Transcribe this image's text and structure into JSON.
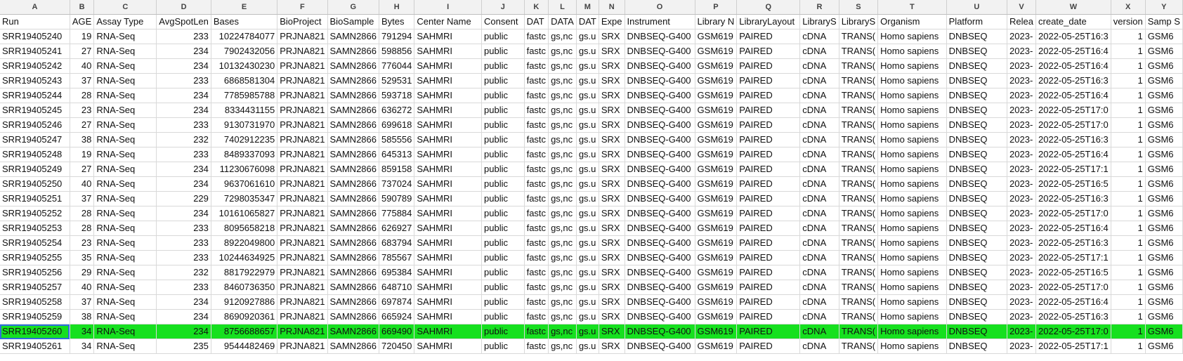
{
  "columns": [
    "A",
    "B",
    "C",
    "D",
    "E",
    "F",
    "G",
    "H",
    "I",
    "J",
    "K",
    "L",
    "M",
    "N",
    "O",
    "P",
    "Q",
    "R",
    "S",
    "T",
    "U",
    "V",
    "W",
    "X",
    "Y"
  ],
  "header_row": [
    "Run",
    "AGE",
    "Assay Type",
    "AvgSpotLen",
    "Bases",
    "BioProject",
    "BioSample",
    "Bytes",
    "Center Name",
    "Consent",
    "DAT",
    "DATA",
    "DAT",
    "Expe",
    "Instrument",
    "Library N",
    "LibraryLayout",
    "LibraryS",
    "LibraryS",
    "Organism",
    "Platform",
    "Relea",
    "create_date",
    "version",
    "Samp S"
  ],
  "rows": [
    [
      "SRR19405240",
      "19",
      "RNA-Seq",
      "233",
      "10224784077",
      "PRJNA821",
      "SAMN2866",
      "791294",
      "SAHMRI",
      "public",
      "fastc",
      "gs,nc",
      "gs.u",
      "SRX",
      "DNBSEQ-G400",
      "GSM619",
      "PAIRED",
      "cDNA",
      "TRANS(",
      "Homo sapiens",
      "DNBSEQ",
      "2023-",
      "2022-05-25T16:3",
      "1",
      "GSM6"
    ],
    [
      "SRR19405241",
      "27",
      "RNA-Seq",
      "234",
      "7902432056",
      "PRJNA821",
      "SAMN2866",
      "598856",
      "SAHMRI",
      "public",
      "fastc",
      "gs,nc",
      "gs.u",
      "SRX",
      "DNBSEQ-G400",
      "GSM619",
      "PAIRED",
      "cDNA",
      "TRANS(",
      "Homo sapiens",
      "DNBSEQ",
      "2023-",
      "2022-05-25T16:4",
      "1",
      "GSM6"
    ],
    [
      "SRR19405242",
      "40",
      "RNA-Seq",
      "234",
      "10132430230",
      "PRJNA821",
      "SAMN2866",
      "776044",
      "SAHMRI",
      "public",
      "fastc",
      "gs,nc",
      "gs.u",
      "SRX",
      "DNBSEQ-G400",
      "GSM619",
      "PAIRED",
      "cDNA",
      "TRANS(",
      "Homo sapiens",
      "DNBSEQ",
      "2023-",
      "2022-05-25T16:4",
      "1",
      "GSM6"
    ],
    [
      "SRR19405243",
      "37",
      "RNA-Seq",
      "233",
      "6868581304",
      "PRJNA821",
      "SAMN2866",
      "529531",
      "SAHMRI",
      "public",
      "fastc",
      "gs,nc",
      "gs.u",
      "SRX",
      "DNBSEQ-G400",
      "GSM619",
      "PAIRED",
      "cDNA",
      "TRANS(",
      "Homo sapiens",
      "DNBSEQ",
      "2023-",
      "2022-05-25T16:3",
      "1",
      "GSM6"
    ],
    [
      "SRR19405244",
      "28",
      "RNA-Seq",
      "234",
      "7785985788",
      "PRJNA821",
      "SAMN2866",
      "593718",
      "SAHMRI",
      "public",
      "fastc",
      "gs,nc",
      "gs.u",
      "SRX",
      "DNBSEQ-G400",
      "GSM619",
      "PAIRED",
      "cDNA",
      "TRANS(",
      "Homo sapiens",
      "DNBSEQ",
      "2023-",
      "2022-05-25T16:4",
      "1",
      "GSM6"
    ],
    [
      "SRR19405245",
      "23",
      "RNA-Seq",
      "234",
      "8334431155",
      "PRJNA821",
      "SAMN2866",
      "636272",
      "SAHMRI",
      "public",
      "fastc",
      "gs,nc",
      "gs.u",
      "SRX",
      "DNBSEQ-G400",
      "GSM619",
      "PAIRED",
      "cDNA",
      "TRANS(",
      "Homo sapiens",
      "DNBSEQ",
      "2023-",
      "2022-05-25T17:0",
      "1",
      "GSM6"
    ],
    [
      "SRR19405246",
      "27",
      "RNA-Seq",
      "233",
      "9130731970",
      "PRJNA821",
      "SAMN2866",
      "699618",
      "SAHMRI",
      "public",
      "fastc",
      "gs,nc",
      "gs.u",
      "SRX",
      "DNBSEQ-G400",
      "GSM619",
      "PAIRED",
      "cDNA",
      "TRANS(",
      "Homo sapiens",
      "DNBSEQ",
      "2023-",
      "2022-05-25T17:0",
      "1",
      "GSM6"
    ],
    [
      "SRR19405247",
      "38",
      "RNA-Seq",
      "232",
      "7402912235",
      "PRJNA821",
      "SAMN2866",
      "585556",
      "SAHMRI",
      "public",
      "fastc",
      "gs,nc",
      "gs.u",
      "SRX",
      "DNBSEQ-G400",
      "GSM619",
      "PAIRED",
      "cDNA",
      "TRANS(",
      "Homo sapiens",
      "DNBSEQ",
      "2023-",
      "2022-05-25T16:3",
      "1",
      "GSM6"
    ],
    [
      "SRR19405248",
      "19",
      "RNA-Seq",
      "233",
      "8489337093",
      "PRJNA821",
      "SAMN2866",
      "645313",
      "SAHMRI",
      "public",
      "fastc",
      "gs,nc",
      "gs.u",
      "SRX",
      "DNBSEQ-G400",
      "GSM619",
      "PAIRED",
      "cDNA",
      "TRANS(",
      "Homo sapiens",
      "DNBSEQ",
      "2023-",
      "2022-05-25T16:4",
      "1",
      "GSM6"
    ],
    [
      "SRR19405249",
      "27",
      "RNA-Seq",
      "234",
      "11230676098",
      "PRJNA821",
      "SAMN2866",
      "859158",
      "SAHMRI",
      "public",
      "fastc",
      "gs,nc",
      "gs.u",
      "SRX",
      "DNBSEQ-G400",
      "GSM619",
      "PAIRED",
      "cDNA",
      "TRANS(",
      "Homo sapiens",
      "DNBSEQ",
      "2023-",
      "2022-05-25T17:1",
      "1",
      "GSM6"
    ],
    [
      "SRR19405250",
      "40",
      "RNA-Seq",
      "234",
      "9637061610",
      "PRJNA821",
      "SAMN2866",
      "737024",
      "SAHMRI",
      "public",
      "fastc",
      "gs,nc",
      "gs.u",
      "SRX",
      "DNBSEQ-G400",
      "GSM619",
      "PAIRED",
      "cDNA",
      "TRANS(",
      "Homo sapiens",
      "DNBSEQ",
      "2023-",
      "2022-05-25T16:5",
      "1",
      "GSM6"
    ],
    [
      "SRR19405251",
      "37",
      "RNA-Seq",
      "229",
      "7298035347",
      "PRJNA821",
      "SAMN2866",
      "590789",
      "SAHMRI",
      "public",
      "fastc",
      "gs,nc",
      "gs.u",
      "SRX",
      "DNBSEQ-G400",
      "GSM619",
      "PAIRED",
      "cDNA",
      "TRANS(",
      "Homo sapiens",
      "DNBSEQ",
      "2023-",
      "2022-05-25T16:3",
      "1",
      "GSM6"
    ],
    [
      "SRR19405252",
      "28",
      "RNA-Seq",
      "234",
      "10161065827",
      "PRJNA821",
      "SAMN2866",
      "775884",
      "SAHMRI",
      "public",
      "fastc",
      "gs,nc",
      "gs.u",
      "SRX",
      "DNBSEQ-G400",
      "GSM619",
      "PAIRED",
      "cDNA",
      "TRANS(",
      "Homo sapiens",
      "DNBSEQ",
      "2023-",
      "2022-05-25T17:0",
      "1",
      "GSM6"
    ],
    [
      "SRR19405253",
      "28",
      "RNA-Seq",
      "233",
      "8095658218",
      "PRJNA821",
      "SAMN2866",
      "626927",
      "SAHMRI",
      "public",
      "fastc",
      "gs,nc",
      "gs.u",
      "SRX",
      "DNBSEQ-G400",
      "GSM619",
      "PAIRED",
      "cDNA",
      "TRANS(",
      "Homo sapiens",
      "DNBSEQ",
      "2023-",
      "2022-05-25T16:4",
      "1",
      "GSM6"
    ],
    [
      "SRR19405254",
      "23",
      "RNA-Seq",
      "233",
      "8922049800",
      "PRJNA821",
      "SAMN2866",
      "683794",
      "SAHMRI",
      "public",
      "fastc",
      "gs,nc",
      "gs.u",
      "SRX",
      "DNBSEQ-G400",
      "GSM619",
      "PAIRED",
      "cDNA",
      "TRANS(",
      "Homo sapiens",
      "DNBSEQ",
      "2023-",
      "2022-05-25T16:3",
      "1",
      "GSM6"
    ],
    [
      "SRR19405255",
      "35",
      "RNA-Seq",
      "233",
      "10244634925",
      "PRJNA821",
      "SAMN2866",
      "785567",
      "SAHMRI",
      "public",
      "fastc",
      "gs,nc",
      "gs.u",
      "SRX",
      "DNBSEQ-G400",
      "GSM619",
      "PAIRED",
      "cDNA",
      "TRANS(",
      "Homo sapiens",
      "DNBSEQ",
      "2023-",
      "2022-05-25T17:1",
      "1",
      "GSM6"
    ],
    [
      "SRR19405256",
      "29",
      "RNA-Seq",
      "232",
      "8817922979",
      "PRJNA821",
      "SAMN2866",
      "695384",
      "SAHMRI",
      "public",
      "fastc",
      "gs,nc",
      "gs.u",
      "SRX",
      "DNBSEQ-G400",
      "GSM619",
      "PAIRED",
      "cDNA",
      "TRANS(",
      "Homo sapiens",
      "DNBSEQ",
      "2023-",
      "2022-05-25T16:5",
      "1",
      "GSM6"
    ],
    [
      "SRR19405257",
      "40",
      "RNA-Seq",
      "233",
      "8460736350",
      "PRJNA821",
      "SAMN2866",
      "648710",
      "SAHMRI",
      "public",
      "fastc",
      "gs,nc",
      "gs.u",
      "SRX",
      "DNBSEQ-G400",
      "GSM619",
      "PAIRED",
      "cDNA",
      "TRANS(",
      "Homo sapiens",
      "DNBSEQ",
      "2023-",
      "2022-05-25T17:0",
      "1",
      "GSM6"
    ],
    [
      "SRR19405258",
      "37",
      "RNA-Seq",
      "234",
      "9120927886",
      "PRJNA821",
      "SAMN2866",
      "697874",
      "SAHMRI",
      "public",
      "fastc",
      "gs,nc",
      "gs.u",
      "SRX",
      "DNBSEQ-G400",
      "GSM619",
      "PAIRED",
      "cDNA",
      "TRANS(",
      "Homo sapiens",
      "DNBSEQ",
      "2023-",
      "2022-05-25T16:4",
      "1",
      "GSM6"
    ],
    [
      "SRR19405259",
      "38",
      "RNA-Seq",
      "234",
      "8690920361",
      "PRJNA821",
      "SAMN2866",
      "665924",
      "SAHMRI",
      "public",
      "fastc",
      "gs,nc",
      "gs.u",
      "SRX",
      "DNBSEQ-G400",
      "GSM619",
      "PAIRED",
      "cDNA",
      "TRANS(",
      "Homo sapiens",
      "DNBSEQ",
      "2023-",
      "2022-05-25T16:3",
      "1",
      "GSM6"
    ],
    [
      "SRR19405260",
      "34",
      "RNA-Seq",
      "234",
      "8756688657",
      "PRJNA821",
      "SAMN2866",
      "669490",
      "SAHMRI",
      "public",
      "fastc",
      "gs,nc",
      "gs.u",
      "SRX",
      "DNBSEQ-G400",
      "GSM619",
      "PAIRED",
      "cDNA",
      "TRANS(",
      "Homo sapiens",
      "DNBSEQ",
      "2023-",
      "2022-05-25T17:0",
      "1",
      "GSM6"
    ],
    [
      "SRR19405261",
      "34",
      "RNA-Seq",
      "235",
      "9544482469",
      "PRJNA821",
      "SAMN2866",
      "720450",
      "SAHMRI",
      "public",
      "fastc",
      "gs,nc",
      "gs.u",
      "SRX",
      "DNBSEQ-G400",
      "GSM619",
      "PAIRED",
      "cDNA",
      "TRANS(",
      "Homo sapiens",
      "DNBSEQ",
      "2023-",
      "2022-05-25T17:1",
      "1",
      "GSM6"
    ]
  ],
  "selected_row_index": 20,
  "colors": {
    "selected_row": "#16e01f",
    "active_cell_border": "#2f6fdc",
    "header_bg": "#f2f2f2",
    "grid": "#d9d9d9"
  }
}
